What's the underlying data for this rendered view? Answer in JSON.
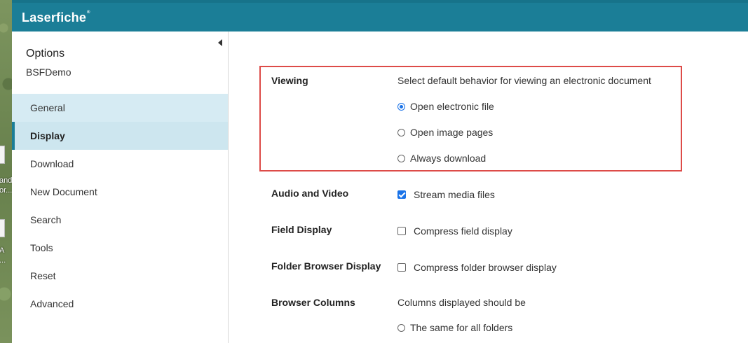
{
  "header": {
    "logo": "Laserfiche",
    "logo_mark": "®"
  },
  "desktop": {
    "labels": [
      "and",
      "or...",
      "A",
      "..."
    ]
  },
  "sidebar": {
    "title": "Options",
    "subtitle": "BSFDemo",
    "items": [
      {
        "label": "General"
      },
      {
        "label": "Display"
      },
      {
        "label": "Download"
      },
      {
        "label": "New Document"
      },
      {
        "label": "Search"
      },
      {
        "label": "Tools"
      },
      {
        "label": "Reset"
      },
      {
        "label": "Advanced"
      }
    ]
  },
  "settings": {
    "viewing": {
      "label": "Viewing",
      "description": "Select default behavior for viewing an electronic document",
      "options": [
        "Open electronic file",
        "Open image pages",
        "Always download"
      ],
      "selected": "Open electronic file"
    },
    "audio_video": {
      "label": "Audio and Video",
      "option": "Stream media files",
      "checked": true
    },
    "field_display": {
      "label": "Field Display",
      "option": "Compress field display",
      "checked": false
    },
    "folder_browser": {
      "label": "Folder Browser Display",
      "option": "Compress folder browser display",
      "checked": false
    },
    "browser_columns": {
      "label": "Browser Columns",
      "description": "Columns displayed should be",
      "options": [
        "The same for all folders"
      ]
    }
  },
  "colors": {
    "header": "#1b7e97",
    "active_nav": "#cde6ef",
    "highlight_border": "#dd4b48",
    "control_accent": "#1a73e8"
  }
}
